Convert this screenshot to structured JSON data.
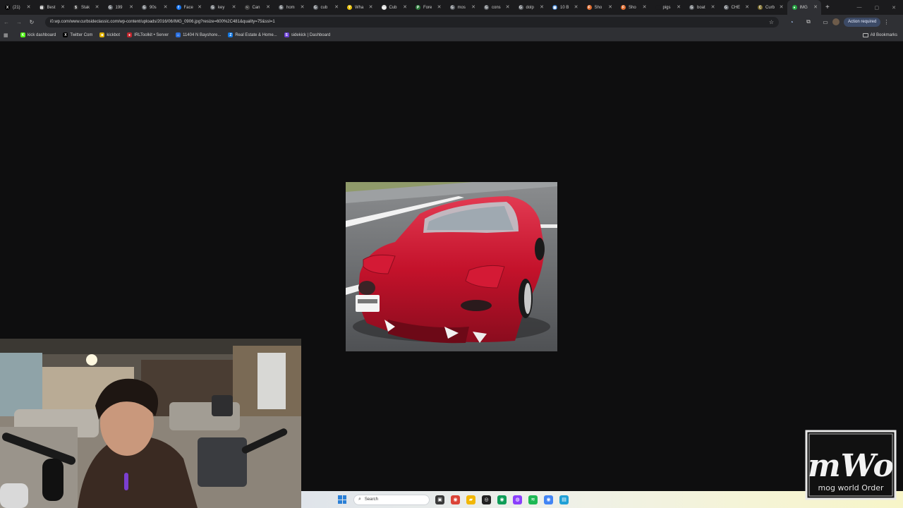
{
  "browser": {
    "tabs": [
      {
        "label": "(21)",
        "favicon": "x-icon",
        "color": "#000000",
        "glyph": "X"
      },
      {
        "label": "Best",
        "favicon": "bookmark-icon",
        "color": "#555555",
        "glyph": "▤"
      },
      {
        "label": "Stak",
        "favicon": "dollar-icon",
        "color": "#333333",
        "glyph": "$"
      },
      {
        "label": "199",
        "favicon": "google-icon",
        "color": "#5f6368",
        "glyph": "G"
      },
      {
        "label": "90s",
        "favicon": "google-icon",
        "color": "#5f6368",
        "glyph": "G"
      },
      {
        "label": "Face",
        "favicon": "facebook-icon",
        "color": "#1877f2",
        "glyph": "f"
      },
      {
        "label": "key",
        "favicon": "google-icon",
        "color": "#5f6368",
        "glyph": "G"
      },
      {
        "label": "Can",
        "favicon": "page-icon",
        "color": "#444444",
        "glyph": "~"
      },
      {
        "label": "hom",
        "favicon": "google-icon",
        "color": "#5f6368",
        "glyph": "G"
      },
      {
        "label": "cub",
        "favicon": "google-icon",
        "color": "#5f6368",
        "glyph": "G"
      },
      {
        "label": "Wha",
        "favicon": "yellow-icon",
        "color": "#e8c10b",
        "glyph": "Y"
      },
      {
        "label": "Cub",
        "favicon": "page-icon",
        "color": "#dddddd",
        "glyph": "▬"
      },
      {
        "label": "Fore",
        "favicon": "p-icon",
        "color": "#2b7a3a",
        "glyph": "P"
      },
      {
        "label": "mos",
        "favicon": "google-icon",
        "color": "#5f6368",
        "glyph": "G"
      },
      {
        "label": "cons",
        "favicon": "google-icon",
        "color": "#5f6368",
        "glyph": "G"
      },
      {
        "label": "dolp",
        "favicon": "google-icon",
        "color": "#5f6368",
        "glyph": "G"
      },
      {
        "label": "10 B",
        "favicon": "list-icon",
        "color": "#2a6fbf",
        "glyph": "▦"
      },
      {
        "label": "Sho",
        "favicon": "f-icon",
        "color": "#e06b2d",
        "glyph": "F"
      },
      {
        "label": "Sho",
        "favicon": "f-icon",
        "color": "#e06b2d",
        "glyph": "F"
      },
      {
        "label": "pigs",
        "favicon": "none-icon",
        "color": "#1b1b1d",
        "glyph": ""
      },
      {
        "label": "boat",
        "favicon": "google-icon",
        "color": "#5f6368",
        "glyph": "G"
      },
      {
        "label": "CHE",
        "favicon": "google-icon",
        "color": "#5f6368",
        "glyph": "G"
      },
      {
        "label": "Curb",
        "favicon": "cc-icon",
        "color": "#7a6a2a",
        "glyph": "C"
      },
      {
        "label": "IMG",
        "favicon": "green-dot-icon",
        "color": "#27a844",
        "glyph": "●",
        "active": true
      }
    ],
    "new_tab": "+",
    "url": "i0.wp.com/www.curbsideclassic.com/wp-content/uploads/2016/06/IMG_0906.jpg?resize=600%2C481&quality=75&ssl=1",
    "action_required": "Action required",
    "bookmarks": [
      {
        "label": "kick dashboard",
        "icon": "kick-icon",
        "color": "#53fc18",
        "glyph": "K"
      },
      {
        "label": "Twitter Com",
        "icon": "x-icon",
        "color": "#000000",
        "glyph": "X"
      },
      {
        "label": "kickbot",
        "icon": "kickbot-icon",
        "color": "#e0b000",
        "glyph": "☻"
      },
      {
        "label": "IRLToolkit • Server",
        "icon": "irl-icon",
        "color": "#c0262d",
        "glyph": "●"
      },
      {
        "label": "11404 N Bayshore...",
        "icon": "home-icon",
        "color": "#2a6fdf",
        "glyph": "⌂"
      },
      {
        "label": "Real Estate & Home...",
        "icon": "zillow-icon",
        "color": "#1277e1",
        "glyph": "Z"
      },
      {
        "label": "sidekick | Dashboard",
        "icon": "sidekick-icon",
        "color": "#6a3fd6",
        "glyph": "S"
      }
    ],
    "all_bookmarks": "All Bookmarks"
  },
  "taskbar": {
    "search_placeholder": "Search",
    "apps": [
      {
        "name": "task-view-icon",
        "color": "#3a3a3a",
        "glyph": "▣"
      },
      {
        "name": "chrome-icon",
        "color": "#db4437",
        "glyph": "◉"
      },
      {
        "name": "file-explorer-icon",
        "color": "#f2b705",
        "glyph": "▰"
      },
      {
        "name": "obs-icon",
        "color": "#222222",
        "glyph": "◎"
      },
      {
        "name": "chrome-alt-icon",
        "color": "#0f9d58",
        "glyph": "◉"
      },
      {
        "name": "messenger-icon",
        "color": "#8a3ffc",
        "glyph": "◍"
      },
      {
        "name": "spotify-icon",
        "color": "#1db954",
        "glyph": "≋"
      },
      {
        "name": "chrome-dev-icon",
        "color": "#4285f4",
        "glyph": "◉"
      },
      {
        "name": "notes-icon",
        "color": "#21a0d6",
        "glyph": "▤"
      }
    ]
  },
  "overlay": {
    "logo_main": "mWo",
    "logo_sub": "mog world Order"
  },
  "colors": {
    "page_bg": "#0e0e0f",
    "chrome_bg": "#2f3034",
    "car_red": "#c4122b"
  }
}
